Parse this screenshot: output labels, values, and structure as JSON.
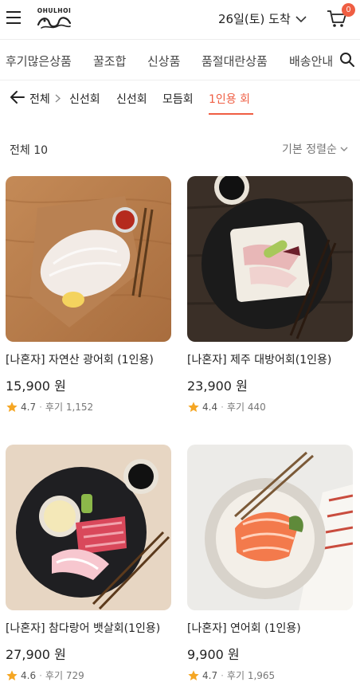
{
  "header": {
    "logo_text": "OHULHOI",
    "delivery_label": "26일(토) 도착",
    "cart_count": "0"
  },
  "categories": [
    "후기많은상품",
    "꿀조합",
    "신상품",
    "품절대란상품",
    "배송안내"
  ],
  "subnav": {
    "items": [
      "전체",
      "신선회",
      "신선회",
      "모듬회",
      "1인용 회"
    ]
  },
  "list": {
    "count_label": "전체 10",
    "sort_label": "기본 정렬순"
  },
  "products": [
    {
      "name": "[나혼자] 자연산 광어회 (1인용)",
      "price": "15,900 원",
      "rating": "4.7",
      "review": "후기 1,152"
    },
    {
      "name": "[나혼자] 제주 대방어회(1인용)",
      "price": "23,900 원",
      "rating": "4.4",
      "review": "후기 440"
    },
    {
      "name": "[나혼자] 참다랑어 뱃살회(1인용)",
      "price": "27,900 원",
      "rating": "4.6",
      "review": "후기 729"
    },
    {
      "name": "[나혼자] 연어회 (1인용)",
      "price": "9,900 원",
      "rating": "4.7",
      "review": "후기 1,965"
    }
  ],
  "colors": {
    "accent": "#ef5e43",
    "star": "#f5a623"
  }
}
